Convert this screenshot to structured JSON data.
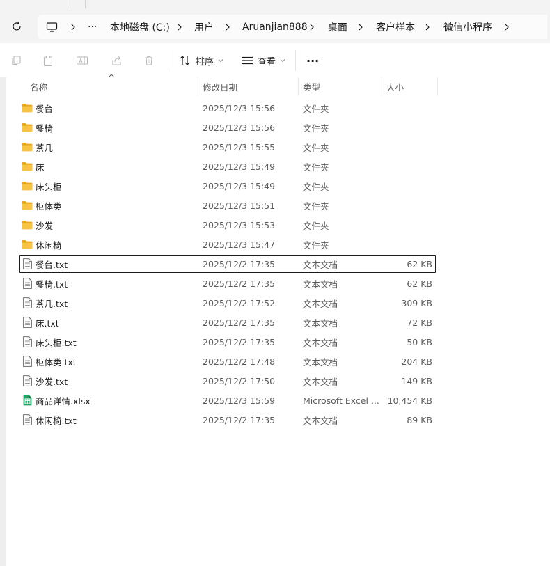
{
  "breadcrumb": {
    "overflow_label": "···",
    "items": [
      "本地磁盘 (C:)",
      "用户",
      "Aruanjian888",
      "桌面",
      "客户样本",
      "微信小程序"
    ]
  },
  "toolbar": {
    "sort_label": "排序",
    "view_label": "查看",
    "more_label": "···"
  },
  "columns": {
    "name": "名称",
    "modified": "修改日期",
    "type": "类型",
    "size": "大小"
  },
  "files": [
    {
      "icon": "folder-icon",
      "name": "餐台",
      "date": "2025/12/3 15:56",
      "type": "文件夹",
      "size": ""
    },
    {
      "icon": "folder-icon",
      "name": "餐椅",
      "date": "2025/12/3 15:56",
      "type": "文件夹",
      "size": ""
    },
    {
      "icon": "folder-icon",
      "name": "茶几",
      "date": "2025/12/3 15:55",
      "type": "文件夹",
      "size": ""
    },
    {
      "icon": "folder-icon",
      "name": "床",
      "date": "2025/12/3 15:49",
      "type": "文件夹",
      "size": ""
    },
    {
      "icon": "folder-icon",
      "name": "床头柜",
      "date": "2025/12/3 15:49",
      "type": "文件夹",
      "size": ""
    },
    {
      "icon": "folder-icon",
      "name": "柜体类",
      "date": "2025/12/3 15:51",
      "type": "文件夹",
      "size": ""
    },
    {
      "icon": "folder-icon",
      "name": "沙发",
      "date": "2025/12/3 15:53",
      "type": "文件夹",
      "size": ""
    },
    {
      "icon": "folder-icon",
      "name": "休闲椅",
      "date": "2025/12/3 15:47",
      "type": "文件夹",
      "size": ""
    },
    {
      "icon": "text-file-icon",
      "name": "餐台.txt",
      "date": "2025/12/2 17:35",
      "type": "文本文档",
      "size": "62 KB",
      "selected": true
    },
    {
      "icon": "text-file-icon",
      "name": "餐椅.txt",
      "date": "2025/12/2 17:35",
      "type": "文本文档",
      "size": "62 KB"
    },
    {
      "icon": "text-file-icon",
      "name": "茶几.txt",
      "date": "2025/12/2 17:52",
      "type": "文本文档",
      "size": "309 KB"
    },
    {
      "icon": "text-file-icon",
      "name": "床.txt",
      "date": "2025/12/2 17:35",
      "type": "文本文档",
      "size": "72 KB"
    },
    {
      "icon": "text-file-icon",
      "name": "床头柜.txt",
      "date": "2025/12/2 17:35",
      "type": "文本文档",
      "size": "50 KB"
    },
    {
      "icon": "text-file-icon",
      "name": "柜体类.txt",
      "date": "2025/12/2 17:48",
      "type": "文本文档",
      "size": "204 KB"
    },
    {
      "icon": "text-file-icon",
      "name": "沙发.txt",
      "date": "2025/12/2 17:50",
      "type": "文本文档",
      "size": "149 KB"
    },
    {
      "icon": "excel-file-icon",
      "name": "商品详情.xlsx",
      "date": "2025/12/3 15:59",
      "type": "Microsoft Excel ...",
      "size": "10,454 KB"
    },
    {
      "icon": "text-file-icon",
      "name": "休闲椅.txt",
      "date": "2025/12/2 17:35",
      "type": "文本文档",
      "size": "89 KB"
    }
  ],
  "colors": {
    "folder": "#f6c343",
    "folder_dark": "#e8a920",
    "excel": "#21a366",
    "selection_border": "#1b1b1b"
  }
}
